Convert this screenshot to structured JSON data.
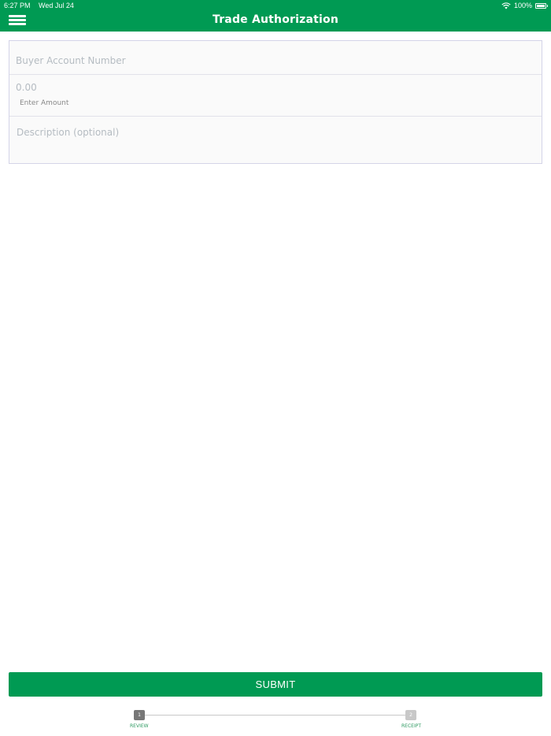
{
  "status_bar": {
    "time": "6:27 PM",
    "date": "Wed Jul 24",
    "battery": "100%",
    "icons": [
      "wifi-icon",
      "battery-icon"
    ]
  },
  "header": {
    "title": "Trade Authorization",
    "menu_icon": "hamburger-menu-icon"
  },
  "form": {
    "buyer_account": {
      "value": "",
      "placeholder": "Buyer Account Number"
    },
    "amount": {
      "value": "",
      "placeholder": "0.00",
      "label": "Enter Amount"
    },
    "description": {
      "value": "",
      "placeholder": "Description (optional)"
    }
  },
  "submit_label": "SUBMIT",
  "stepper": {
    "steps": [
      {
        "number": "1",
        "label": "REVIEW",
        "active": true
      },
      {
        "number": "2",
        "label": "RECEIPT",
        "active": false
      }
    ]
  },
  "colors": {
    "brand_green": "#009a53",
    "step_label_green": "#2e9a61",
    "active_step": "#777777",
    "inactive_step": "#c8c8c8"
  }
}
